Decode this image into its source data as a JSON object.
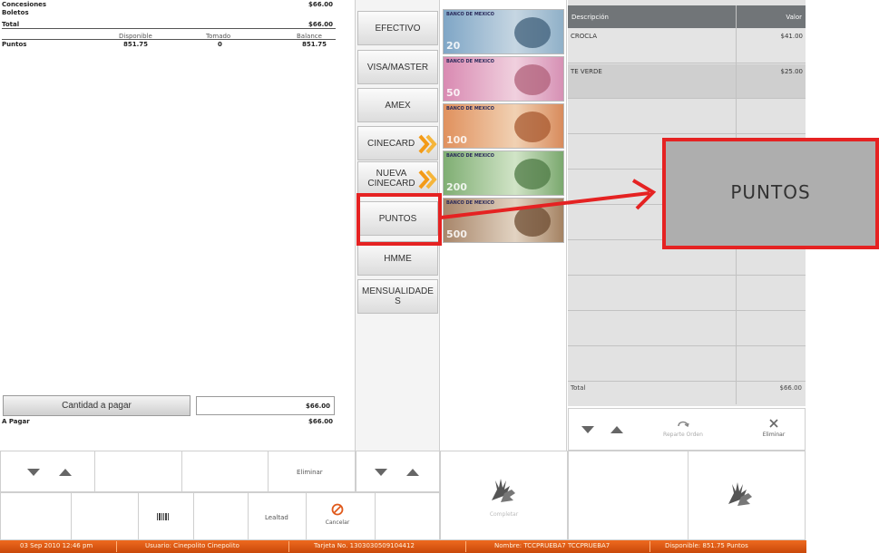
{
  "summary": {
    "concesiones_label": "Concesiones",
    "concesiones_value": "$66.00",
    "boletos_label": "Boletos",
    "total_label": "Total",
    "total_value": "$66.00",
    "col_disponible": "Disponible",
    "col_tomado": "Tomado",
    "col_balance": "Balance",
    "puntos_label": "Puntos",
    "puntos_disponible": "851.75",
    "puntos_tomado": "0",
    "puntos_balance": "851.75",
    "cantidad_button": "Cantidad a pagar",
    "cantidad_value": "$66.00",
    "a_pagar_label": "A Pagar",
    "a_pagar_value": "$66.00"
  },
  "payment_methods": [
    {
      "label": "EFECTIVO",
      "chevron": false
    },
    {
      "label": "VISA/MASTER",
      "chevron": false
    },
    {
      "label": "AMEX",
      "chevron": false
    },
    {
      "label": "CINECARD",
      "chevron": true
    },
    {
      "label": "NUEVA CINECARD",
      "chevron": true
    },
    {
      "label": "PUNTOS",
      "chevron": false
    },
    {
      "label": "HMME",
      "chevron": false
    },
    {
      "label": "MENSUALIDADES",
      "chevron": false
    }
  ],
  "bills": [
    {
      "amount": "20",
      "header": "BANCO DE MEXICO",
      "color": "#5d8fb8"
    },
    {
      "amount": "50",
      "header": "BANCO DE MEXICO",
      "color": "#c56a9a"
    },
    {
      "amount": "100",
      "header": "BANCO DE MEXICO",
      "color": "#d27a4a"
    },
    {
      "amount": "200",
      "header": "BANCO DE MEXICO",
      "color": "#5f9a55"
    },
    {
      "amount": "500",
      "header": "BANCO DE MEXICO",
      "color": "#8a6a4a"
    }
  ],
  "order_table": {
    "col_descripcion": "Descripción",
    "col_valor": "Valor",
    "rows": [
      {
        "desc": "CROCLA",
        "value": "$41.00"
      },
      {
        "desc": "TE VERDE",
        "value": "$25.00"
      }
    ],
    "total_label": "Total",
    "total_value": "$66.00",
    "reparte_label": "Reparte Orden",
    "eliminar_label": "Eliminar"
  },
  "bottom_controls": {
    "eliminar_label": "Eliminar",
    "lealtad_label": "Lealtad",
    "cancelar_label": "Cancelar",
    "completar_label": "Completar"
  },
  "status_bar": {
    "date": "03 Sep 2010 12:46 pm",
    "usuario": "Usuario: Cinepolito Cinepolito",
    "tarjeta": "Tarjeta No. 1303030509104412",
    "nombre": "Nombre: TCCPRUEBA7 TCCPRUEBA7",
    "disponible": "Disponible: 851.75 Puntos"
  },
  "callout": {
    "label": "PUNTOS"
  },
  "colors": {
    "accent_red": "#e52222",
    "status_orange": "#e0601a",
    "header_gray": "#717578"
  }
}
